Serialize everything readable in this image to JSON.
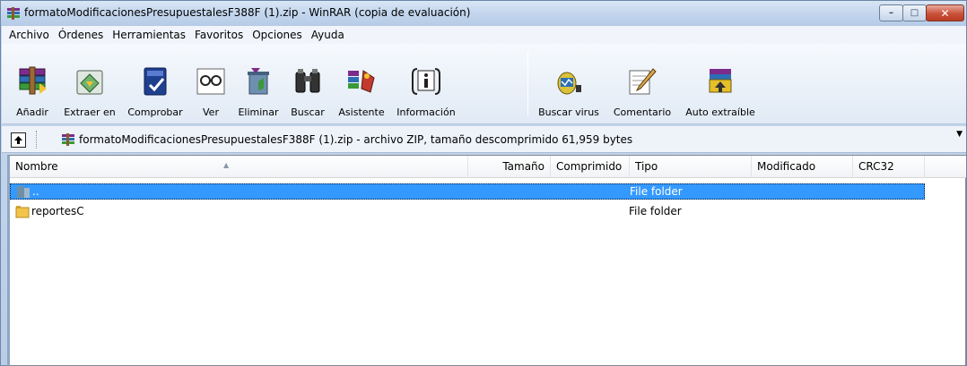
{
  "window": {
    "title": "formatoModificacionesPresupuestalesF388F (1).zip - WinRAR (copia de evaluación)",
    "controls": {
      "minimize": "–",
      "maximize": "□",
      "close": "✕"
    }
  },
  "menu": {
    "items": [
      "Archivo",
      "Órdenes",
      "Herramientas",
      "Favoritos",
      "Opciones",
      "Ayuda"
    ]
  },
  "toolbar": {
    "buttons": [
      {
        "label": "Añadir",
        "icon": "add-books-icon"
      },
      {
        "label": "Extraer en",
        "icon": "extract-icon"
      },
      {
        "label": "Comprobar",
        "icon": "test-icon"
      },
      {
        "label": "Ver",
        "icon": "view-glasses-icon"
      },
      {
        "label": "Eliminar",
        "icon": "delete-trash-icon"
      },
      {
        "label": "Buscar",
        "icon": "binoculars-icon"
      },
      {
        "label": "Asistente",
        "icon": "wizard-icon"
      },
      {
        "label": "Información",
        "icon": "info-icon"
      },
      {
        "label": "Buscar virus",
        "icon": "virus-scan-icon"
      },
      {
        "label": "Comentario",
        "icon": "comment-pen-icon"
      },
      {
        "label": "Auto extraíble",
        "icon": "sfx-box-icon"
      }
    ]
  },
  "address": {
    "text": "formatoModificacionesPresupuestalesF388F (1).zip - archivo ZIP, tamaño descomprimido 61,959 bytes",
    "up_icon": "up-arrow-icon",
    "dropdown_icon": "▼"
  },
  "columns": {
    "name": "Nombre",
    "size": "Tamaño",
    "packed": "Comprimido",
    "type": "Tipo",
    "modified": "Modificado",
    "crc": "CRC32"
  },
  "rows": [
    {
      "name": "..",
      "type": "File folder",
      "selected": true
    },
    {
      "name": "reportesC",
      "type": "File folder",
      "selected": false
    }
  ],
  "colors": {
    "selection": "#3399ff",
    "titlebar": "#c3d6ee",
    "close_button": "#c9513a"
  }
}
